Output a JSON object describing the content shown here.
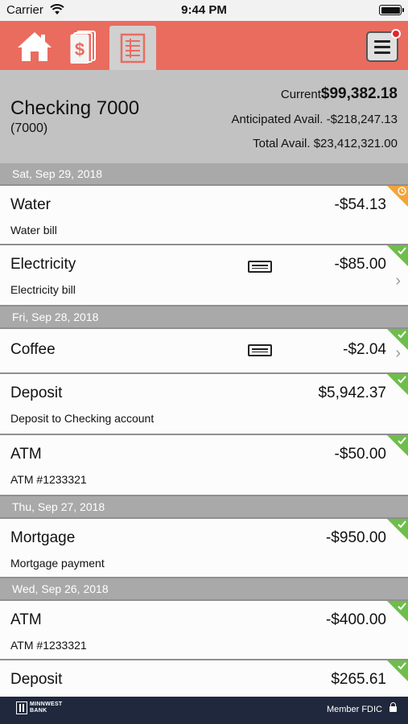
{
  "status_bar": {
    "carrier": "Carrier",
    "time": "9:44 PM"
  },
  "nav": {
    "items": [
      {
        "icon": "home-icon"
      },
      {
        "icon": "money-icon"
      },
      {
        "icon": "register-icon"
      }
    ],
    "active_index": 2,
    "menu_icon": "hamburger-menu-icon",
    "has_notification": true
  },
  "account": {
    "name": "Checking 7000",
    "number": "(7000)",
    "current_label": "Current",
    "current_value": "$99,382.18",
    "anticipated_label": "Anticipated Avail.",
    "anticipated_value": "-$218,247.13",
    "total_label": "Total Avail.",
    "total_value": "$23,412,321.00"
  },
  "groups": [
    {
      "date": "Sat, Sep 29, 2018",
      "transactions": [
        {
          "title": "Water",
          "subtitle": "Water bill",
          "amount": "-$54.13",
          "status": "pending",
          "has_card": false,
          "has_chevron": false
        },
        {
          "title": "Electricity",
          "subtitle": "Electricity bill",
          "amount": "-$85.00",
          "status": "cleared",
          "has_card": true,
          "has_chevron": true
        }
      ]
    },
    {
      "date": "Fri, Sep 28, 2018",
      "transactions": [
        {
          "title": "Coffee",
          "subtitle": "",
          "amount": "-$2.04",
          "status": "cleared",
          "has_card": true,
          "has_chevron": true
        },
        {
          "title": "Deposit",
          "subtitle": "Deposit to Checking account",
          "amount": "$5,942.37",
          "status": "cleared",
          "has_card": false,
          "has_chevron": false
        },
        {
          "title": "ATM",
          "subtitle": "ATM #1233321",
          "amount": "-$50.00",
          "status": "cleared",
          "has_card": false,
          "has_chevron": false
        }
      ]
    },
    {
      "date": "Thu, Sep 27, 2018",
      "transactions": [
        {
          "title": "Mortgage",
          "subtitle": "Mortgage payment",
          "amount": "-$950.00",
          "status": "cleared",
          "has_card": false,
          "has_chevron": false
        }
      ]
    },
    {
      "date": "Wed, Sep 26, 2018",
      "transactions": [
        {
          "title": "ATM",
          "subtitle": "ATM #1233321",
          "amount": "-$400.00",
          "status": "cleared",
          "has_card": false,
          "has_chevron": false
        },
        {
          "title": "Deposit",
          "subtitle": "",
          "amount": "$265.61",
          "status": "cleared",
          "has_card": false,
          "has_chevron": false
        }
      ]
    }
  ],
  "footer": {
    "bank_name_line1": "MINNWEST",
    "bank_name_line2": "BANK",
    "fdic": "Member FDIC",
    "lock_icon": "lock-icon"
  },
  "colors": {
    "nav": "#e96c5f",
    "header": "#c2c2c2",
    "date_bar": "#a9a9a9",
    "cleared": "#6ebe4a",
    "pending": "#f2a43a",
    "footer": "#20283d"
  }
}
